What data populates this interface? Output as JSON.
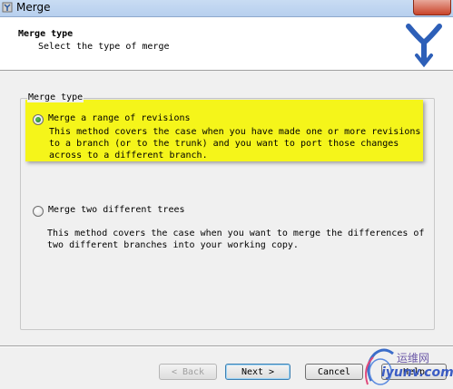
{
  "window": {
    "title": "Merge"
  },
  "header": {
    "title": "Merge type",
    "subtitle": "Select the type of merge"
  },
  "group": {
    "legend": "Merge type",
    "options": [
      {
        "label": "Merge a range of revisions",
        "selected": true,
        "description": "This method covers the case when you have made one or more revisions\nto a branch (or to the trunk) and you want to port those changes\nacross to a different branch."
      },
      {
        "label": "Merge two different trees",
        "selected": false,
        "description": "This method covers the case when you want to merge the differences of\ntwo different branches into your working copy."
      }
    ]
  },
  "buttons": {
    "back": "< Back",
    "next": "Next >",
    "cancel": "Cancel",
    "help": "Help"
  },
  "watermark": {
    "text1": "运维网",
    "text2": "iyunv.com"
  }
}
